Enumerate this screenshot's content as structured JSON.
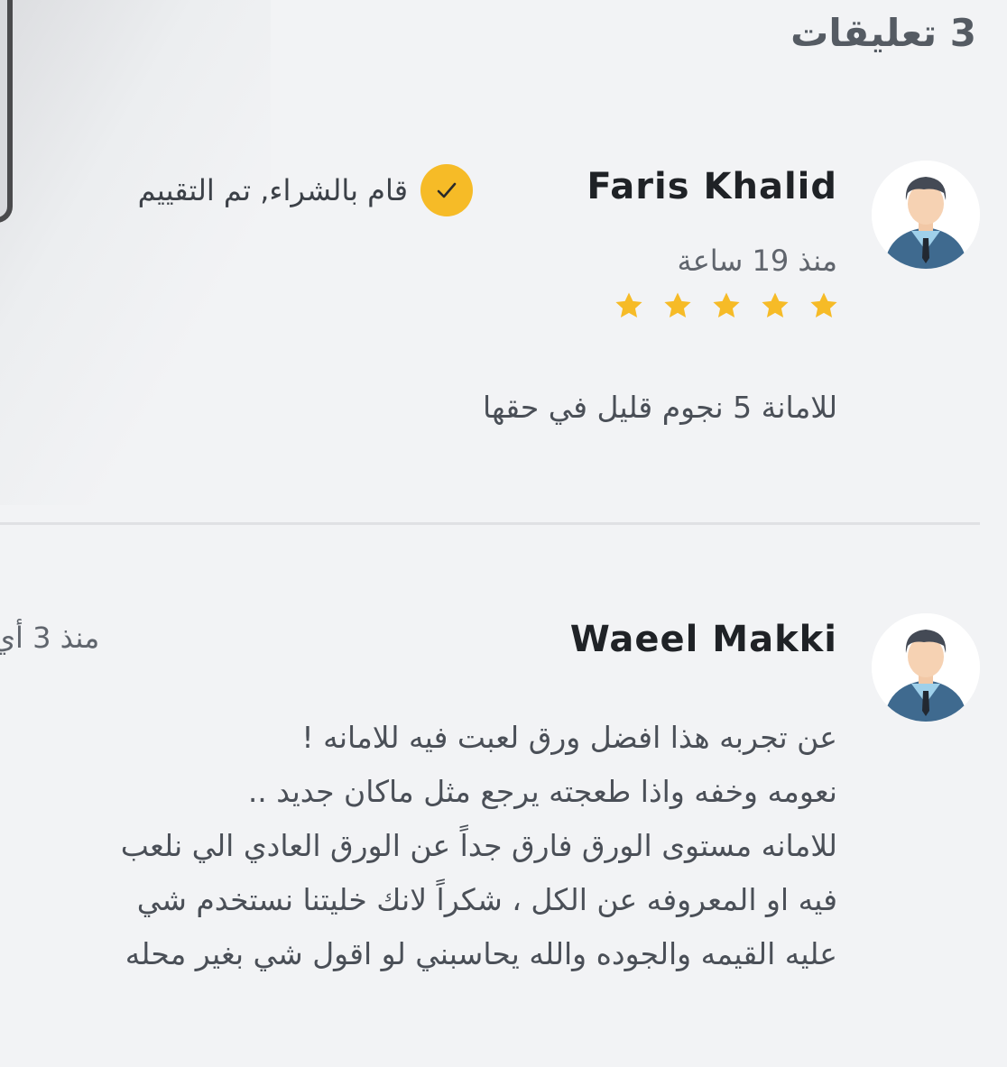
{
  "header": {
    "title": "3 تعليقات"
  },
  "reviews": [
    {
      "name": "Faris Khalid",
      "verified_label": "قام بالشراء, تم التقييم",
      "time": "منذ 19 ساعة",
      "rating": 5,
      "text": "للامانة 5 نجوم قليل في حقها"
    },
    {
      "name": "Waeel Makki",
      "time": "منذ 3 أي",
      "lines": [
        "عن تجربه هذا افضل ورق لعبت فيه للامانه !",
        "نعومه وخفه واذا طعجته يرجع مثل ماكان جديد ..",
        "للامانه مستوى الورق فارق جداً عن الورق العادي الي نلعب",
        "فيه او المعروفه عن الكل ، شكراً لانك خليتنا نستخدم شي",
        "عليه القيمه والجوده والله يحاسبني لو اقول شي بغير محله"
      ]
    }
  ],
  "colors": {
    "background": "#f2f3f5",
    "accent_yellow": "#f6bb27",
    "avatar_suit": "#3f6a8f",
    "avatar_hair": "#444a55",
    "divider": "#e0e1e4"
  },
  "icons": [
    "user-avatar-icon",
    "check-icon",
    "star-icon"
  ]
}
